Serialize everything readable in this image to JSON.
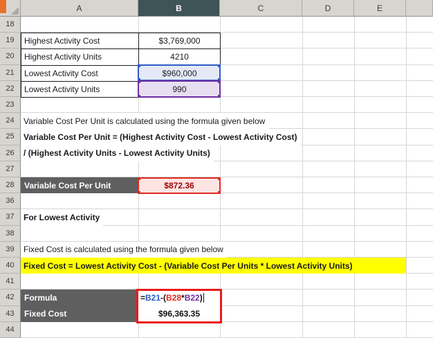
{
  "column_headers": {
    "a": "A",
    "b": "B",
    "c": "C",
    "d": "D",
    "e": "E",
    "f": ""
  },
  "row_numbers": {
    "r18": "18",
    "r19": "19",
    "r20": "20",
    "r21": "21",
    "r22": "22",
    "r23": "23",
    "r24": "24",
    "r25": "25",
    "r26": "26",
    "r27": "27",
    "r28": "28",
    "r36": "36",
    "r37": "37",
    "r38": "38",
    "r39": "39",
    "r40": "40",
    "r41": "41",
    "r42": "42",
    "r43": "43",
    "r44": "44"
  },
  "cells": {
    "a19": "Highest Activity Cost",
    "b19": "$3,769,000",
    "a20": "Highest Activity Units",
    "b20": "4210",
    "a21": "Lowest Activity Cost",
    "b21": "$960,000",
    "a22": "Lowest Activity Units",
    "b22": "990",
    "text24": "Variable Cost Per Unit is calculated using the formula given below",
    "text25": "Variable Cost Per Unit = (Highest Activity Cost - Lowest Activity Cost)",
    "text26": "/ (Highest Activity Units - Lowest Activity Units)",
    "a28": "Variable Cost Per Unit",
    "b28": "$872.36",
    "text37": "For Lowest Activity",
    "text39": "Fixed Cost is calculated using the formula given below",
    "text40": "Fixed Cost = Lowest Activity Cost - (Variable Cost Per Units * Lowest Activity Units)",
    "a42": "Formula",
    "a43": "Fixed Cost",
    "b43": "$96,363.35"
  },
  "formula": {
    "segments": [
      {
        "text": "=",
        "color": "#111111"
      },
      {
        "text": "B21",
        "color": "#2f5bc7"
      },
      {
        "text": "-(",
        "color": "#111111"
      },
      {
        "text": "B28",
        "color": "#e02a20"
      },
      {
        "text": "*",
        "color": "#111111"
      },
      {
        "text": "B22",
        "color": "#7030a0"
      },
      {
        "text": ")",
        "color": "#111111"
      }
    ]
  },
  "colors": {
    "selected_column_header": "#3f5457",
    "highlight_yellow": "#ffff00",
    "dark_label_bg": "#5f5f5f",
    "result_bad_fill": "#fbe4e2",
    "result_bad_text": "#9c0006",
    "ref_blue": "#2f5bc7",
    "ref_red": "#e02a20",
    "ref_purple": "#7030a0",
    "annotation_red": "#ea1a18"
  }
}
